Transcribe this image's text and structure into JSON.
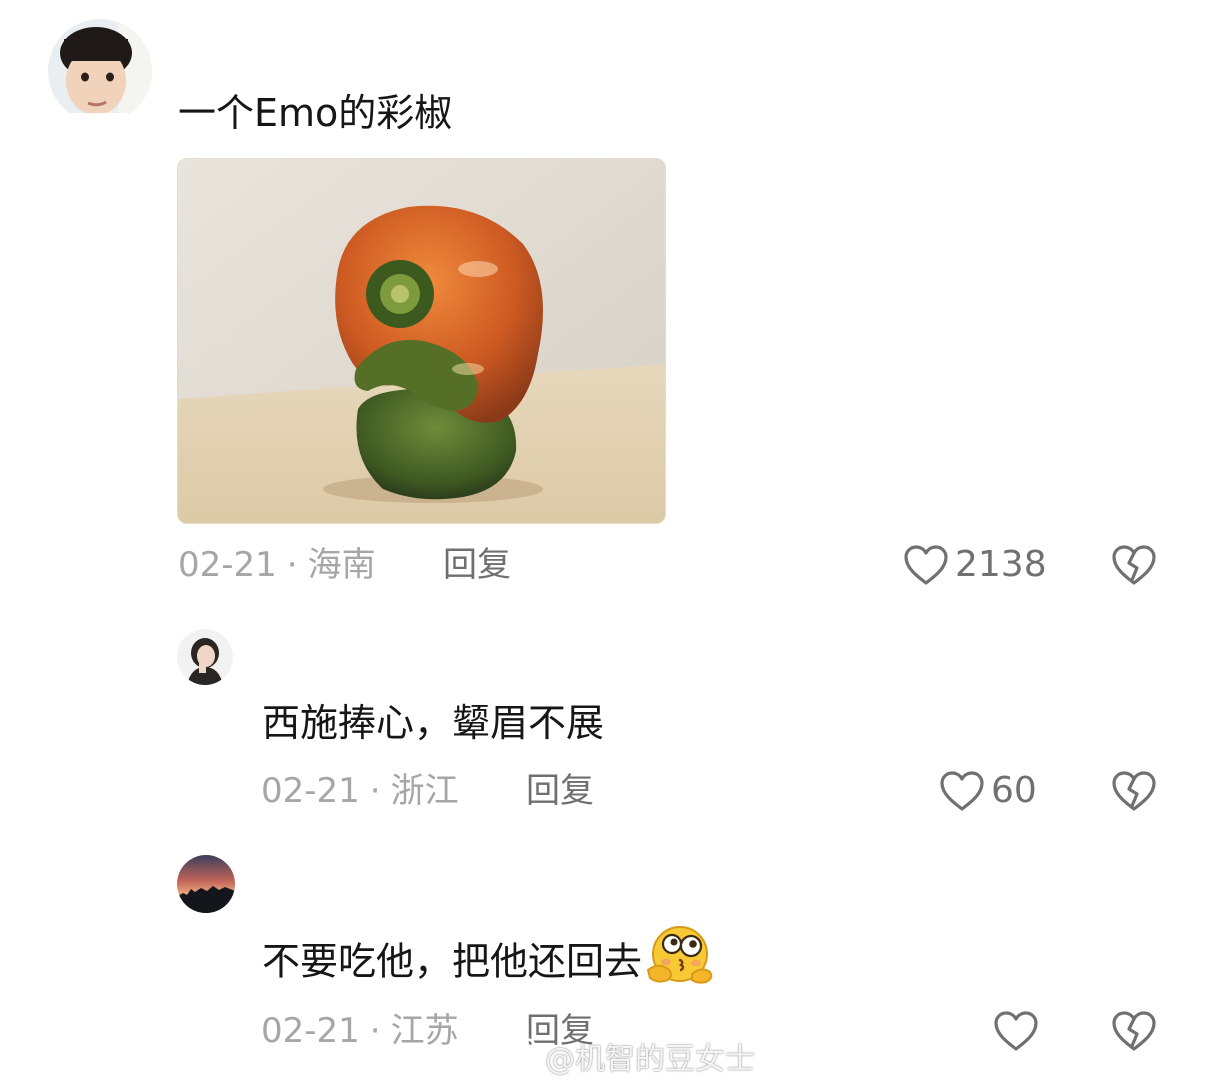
{
  "comments": [
    {
      "text": "一个Emo的彩椒",
      "date": "02-21",
      "location": "海南",
      "reply_label": "回复",
      "likes": "2138"
    }
  ],
  "replies": [
    {
      "text": "西施捧心，颦眉不展",
      "date": "02-21",
      "location": "浙江",
      "reply_label": "回复",
      "likes": "60"
    },
    {
      "text": "不要吃他，把他还回去",
      "date": "02-21",
      "location": "江苏",
      "reply_label": "回复",
      "likes": ""
    }
  ],
  "separator": "·",
  "watermark": "@机智的豆女士",
  "icons": {
    "like": "heart-outline-icon",
    "dislike": "broken-heart-icon",
    "emoji": "thinking-shy-face-emoji",
    "watermark": "weibo-logo-icon"
  },
  "colors": {
    "text": "#161616",
    "meta": "#a6a6a6",
    "icon": "#707070"
  }
}
